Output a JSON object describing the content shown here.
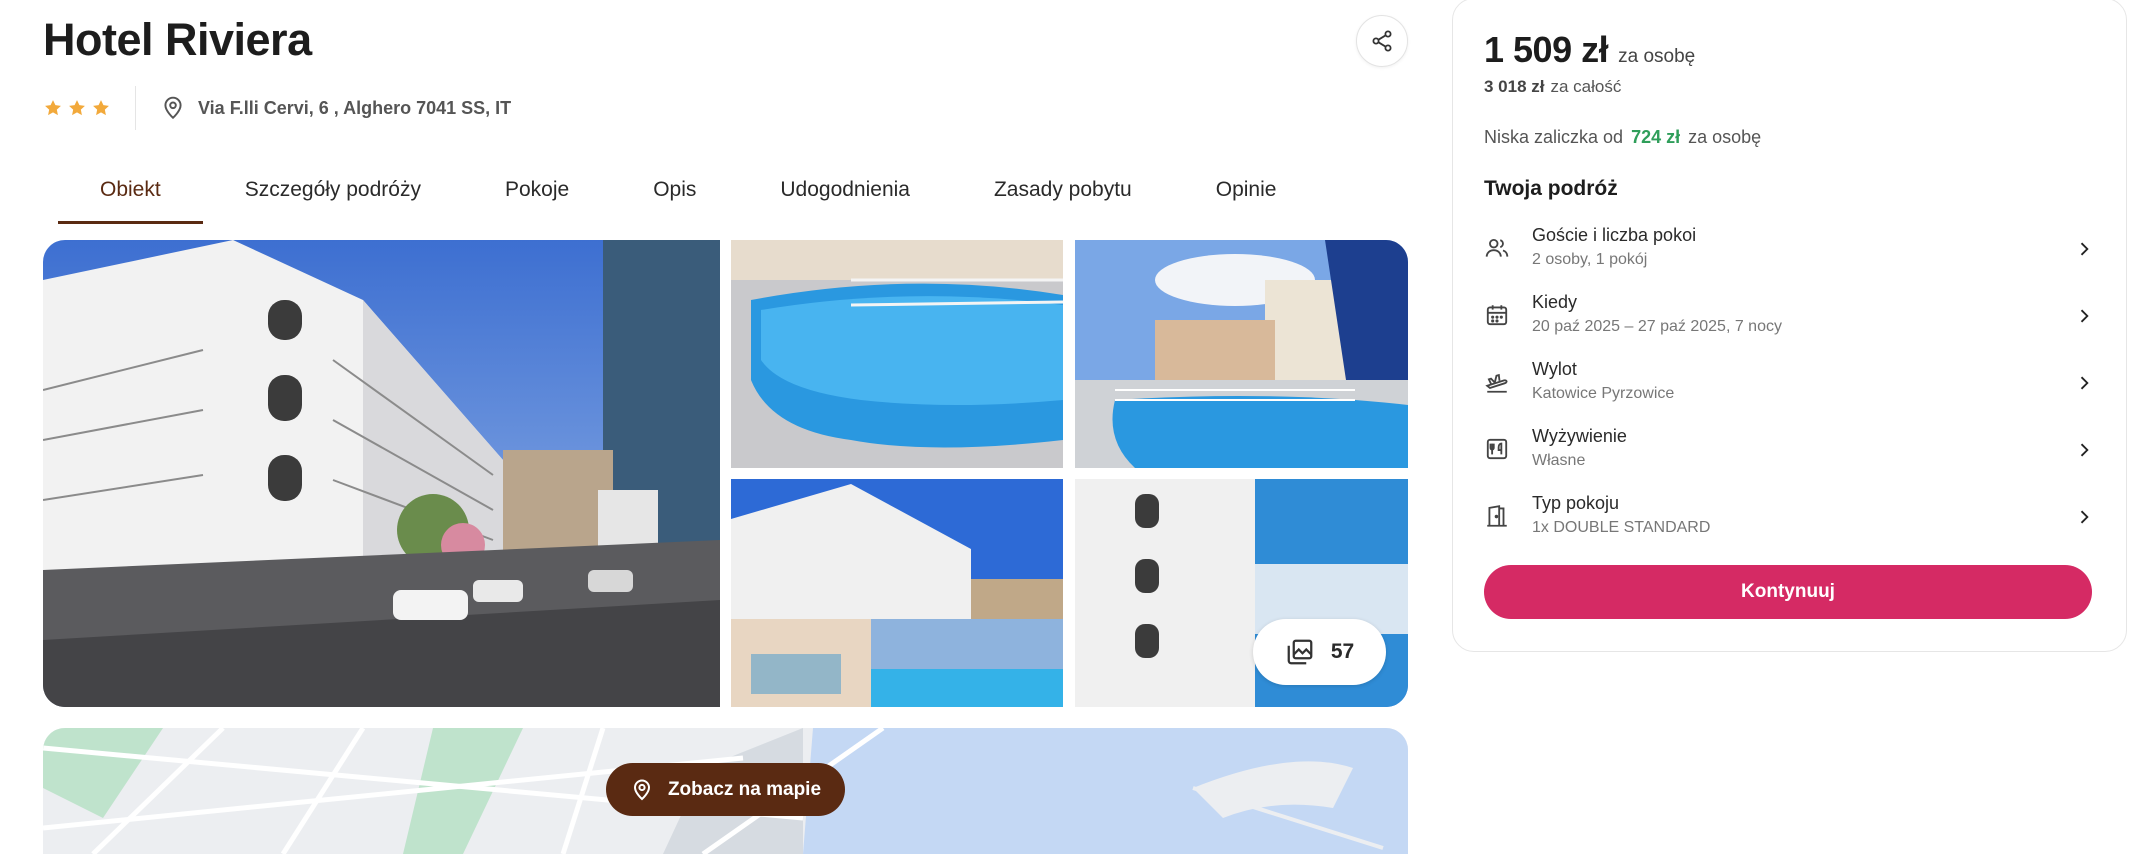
{
  "hotel": {
    "name": "Hotel Riviera",
    "stars": 3,
    "address": "Via F.lli Cervi, 6 , Alghero 7041 SS, IT"
  },
  "tabs": [
    {
      "label": "Obiekt",
      "active": true
    },
    {
      "label": "Szczegóły podróży",
      "active": false
    },
    {
      "label": "Pokoje",
      "active": false
    },
    {
      "label": "Opis",
      "active": false
    },
    {
      "label": "Udogodnienia",
      "active": false
    },
    {
      "label": "Zasady pobytu",
      "active": false
    },
    {
      "label": "Opinie",
      "active": false
    }
  ],
  "gallery": {
    "photo_count": "57"
  },
  "map": {
    "button_label": "Zobacz na mapie"
  },
  "booking": {
    "price_per_person": "1 509 zł",
    "per_person_suffix": "za osobę",
    "price_total": "3 018 zł",
    "total_suffix": "za całość",
    "deposit_prefix": "Niska zaliczka od",
    "deposit_amount": "724 zł",
    "deposit_suffix": "za osobę",
    "trip_title": "Twoja podróż",
    "trip_rows": [
      {
        "label": "Goście i liczba pokoi",
        "value": "2 osoby, 1 pokój",
        "icon": "guests-icon"
      },
      {
        "label": "Kiedy",
        "value": "20 paź 2025 – 27 paź 2025, 7 nocy",
        "icon": "calendar-icon"
      },
      {
        "label": "Wylot",
        "value": "Katowice Pyrzowice",
        "icon": "plane-departure-icon"
      },
      {
        "label": "Wyżywienie",
        "value": "Własne",
        "icon": "meal-icon"
      },
      {
        "label": "Typ pokoju",
        "value": "1x DOUBLE STANDARD",
        "icon": "door-icon"
      }
    ],
    "continue_label": "Kontynuuj"
  },
  "colors": {
    "accent_brown": "#5a2a12",
    "cta_pink": "#d52a64",
    "deposit_green": "#2f9e5a",
    "star_gold": "#f2a93b"
  }
}
